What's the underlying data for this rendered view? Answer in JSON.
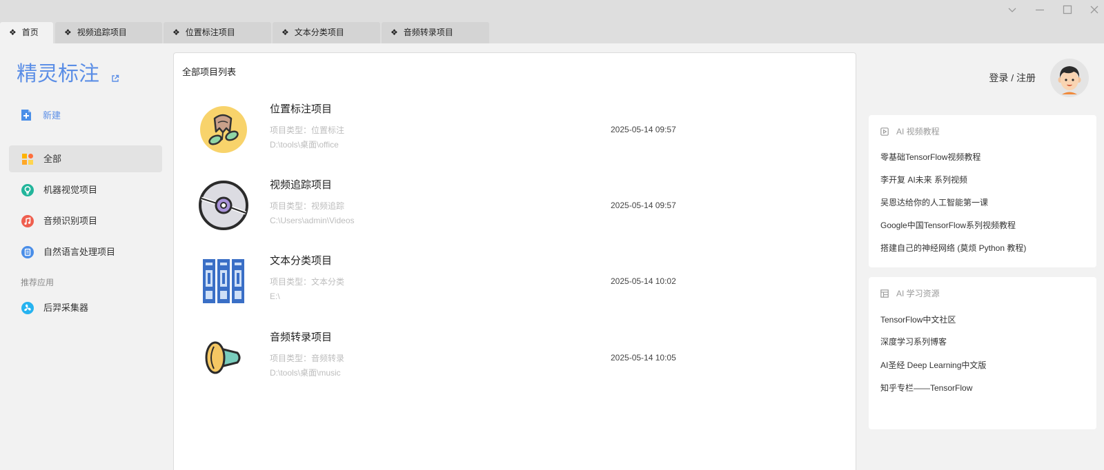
{
  "colors": {
    "accent": "#5b8ee6",
    "page_bg": "#f2f2f2",
    "titlebar_bg": "#dedede",
    "tab_bg": "#d4d4d4"
  },
  "window_controls": [
    {
      "icon": "chevron-down-icon"
    },
    {
      "icon": "minimize-icon"
    },
    {
      "icon": "maximize-icon"
    },
    {
      "icon": "close-icon"
    }
  ],
  "tabs": [
    {
      "glyph": "❖",
      "label": "首页",
      "active": true
    },
    {
      "glyph": "❖",
      "label": "视频追踪项目",
      "active": false
    },
    {
      "glyph": "❖",
      "label": "位置标注项目",
      "active": false
    },
    {
      "glyph": "❖",
      "label": "文本分类项目",
      "active": false
    },
    {
      "glyph": "❖",
      "label": "音频转录项目",
      "active": false
    }
  ],
  "sidebar": {
    "app_title": "精灵标注",
    "app_title_icon": "external-link-icon",
    "new_button": {
      "label": "新建",
      "icon": "new-document-icon",
      "color": "#4a8fe8"
    },
    "nav": [
      {
        "label": "全部",
        "icon": "grid-icon",
        "active": true
      },
      {
        "label": "机器视觉项目",
        "icon": "bulb-icon",
        "color": "#22b59b"
      },
      {
        "label": "音频识别项目",
        "icon": "music-note-icon",
        "color": "#ef5f4f"
      },
      {
        "label": "自然语言处理项目",
        "icon": "document-icon",
        "color": "#4a8ee8"
      }
    ],
    "recommend_heading": "推荐应用",
    "recommend": [
      {
        "label": "后羿采集器",
        "icon": "pinwheel-icon",
        "color": "#26b3f0"
      }
    ]
  },
  "main": {
    "heading": "全部项目列表",
    "projects": [
      {
        "title": "位置标注项目",
        "type": "项目类型：位置标注",
        "path": "D:\\tools\\桌面\\office",
        "date": "2025-05-14 09:57",
        "icon": "location-tag-icon"
      },
      {
        "title": "视频追踪项目",
        "type": "项目类型：视频追踪",
        "path": "C:\\Users\\admin\\Videos",
        "date": "2025-05-14 09:57",
        "icon": "disc-icon"
      },
      {
        "title": "文本分类项目",
        "type": "项目类型：文本分类",
        "path": "E:\\",
        "date": "2025-05-14 10:02",
        "icon": "binders-icon"
      },
      {
        "title": "音频转录项目",
        "type": "项目类型：音频转录",
        "path": "D:\\tools\\桌面\\music",
        "date": "2025-05-14 10:05",
        "icon": "megaphone-icon"
      }
    ]
  },
  "account": {
    "login_label": "登录 / 注册",
    "avatar_icon": "avatar-icon"
  },
  "resources": [
    {
      "title": "AI 视频教程",
      "icon": "video-play-icon",
      "links": [
        "零基础TensorFlow视频教程",
        "李开复 AI未来 系列视频",
        "吴恩达给你的人工智能第一课",
        "Google中国TensorFlow系列视频教程",
        "搭建自己的神经网络 (莫烦 Python 教程)"
      ]
    },
    {
      "title": "AI 学习资源",
      "icon": "table-icon",
      "links": [
        "TensorFlow中文社区",
        "深度学习系列博客",
        "AI圣经 Deep Learning中文版",
        "知乎专栏——TensorFlow"
      ]
    }
  ]
}
